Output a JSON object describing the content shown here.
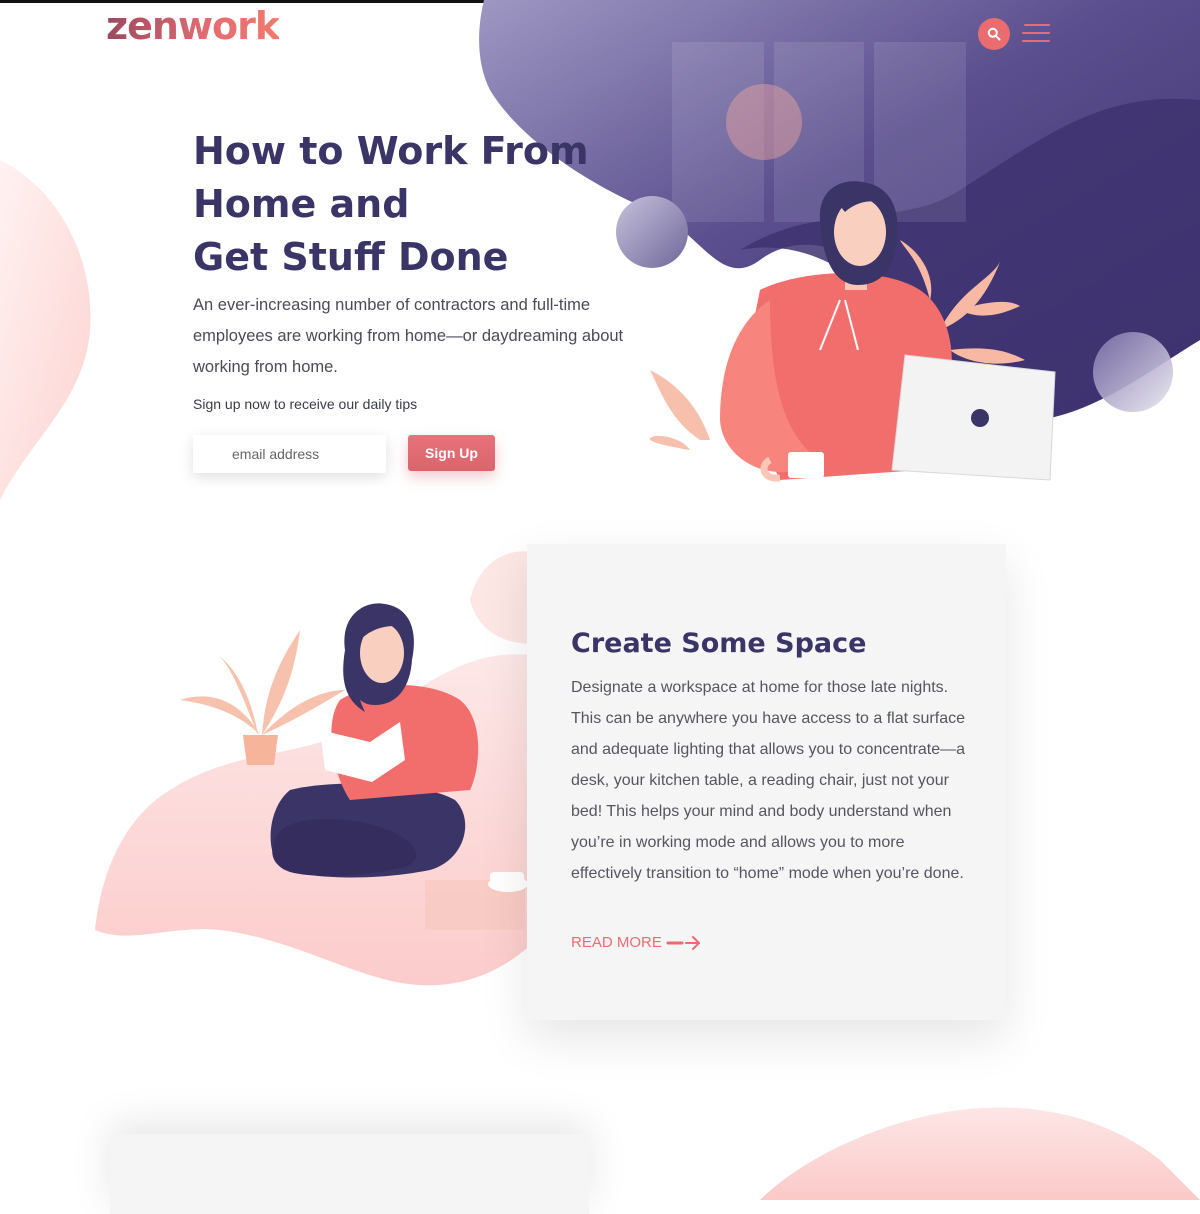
{
  "brand": {
    "logo_text": "zenwork",
    "accent_color": "#e96c6f",
    "primary_color": "#3a3467"
  },
  "header": {
    "search_icon": "search-icon",
    "menu_icon": "hamburger-menu-icon"
  },
  "hero": {
    "title_line1": "How to Work From",
    "title_line2": "Home and",
    "title_line3": "Get Stuff Done",
    "description": "An ever-increasing number of contractors and full-time employees are working from home—or daydreaming about working from home.",
    "signup_label": "Sign up now to receive our daily tips",
    "email_placeholder": "email address",
    "signup_button": "Sign Up"
  },
  "feature_card": {
    "title": "Create Some Space",
    "text": "Designate a workspace at home for those late nights. This can be anywhere you have access to a flat surface and adequate lighting that allows you to concentrate—a desk, your kitchen table, a reading chair, just not your bed! This helps your mind and body understand when you’re in working mode and allows you to more effectively transition to “home” mode when you’re done.",
    "read_more": "READ MORE",
    "read_more_icon": "arrow-right-icon"
  }
}
